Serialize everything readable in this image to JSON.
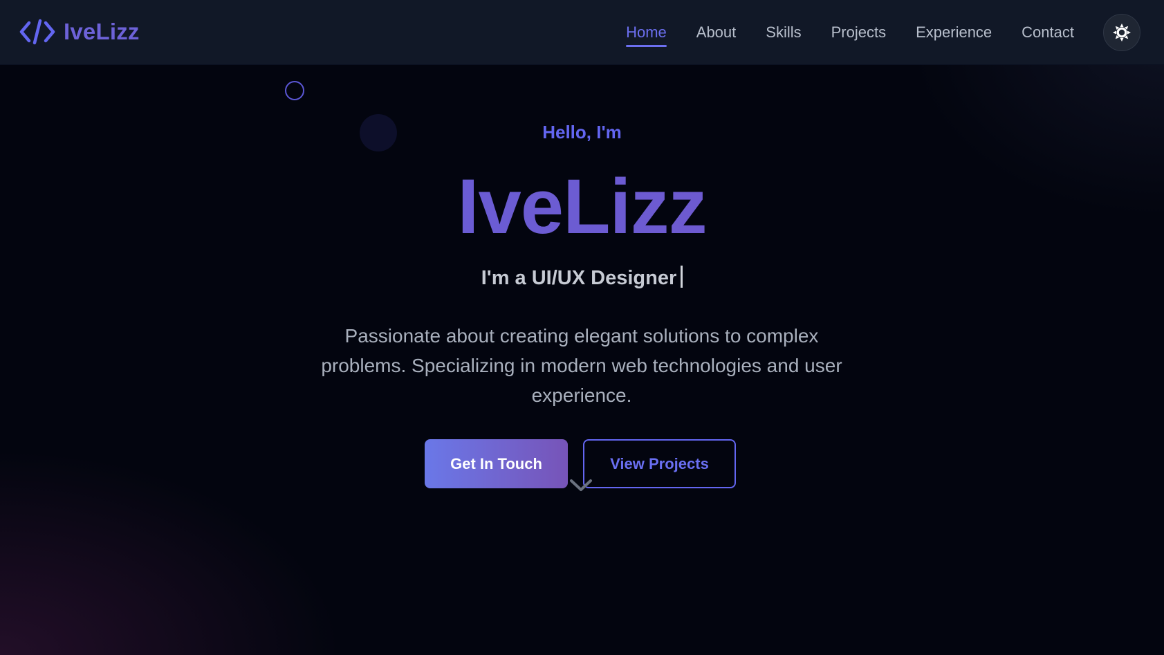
{
  "brand": {
    "name": "IveLizz",
    "icon": "code-brackets-icon"
  },
  "nav": {
    "items": [
      {
        "label": "Home",
        "active": true
      },
      {
        "label": "About",
        "active": false
      },
      {
        "label": "Skills",
        "active": false
      },
      {
        "label": "Projects",
        "active": false
      },
      {
        "label": "Experience",
        "active": false
      },
      {
        "label": "Contact",
        "active": false
      }
    ],
    "theme_toggle_icon": "sun-icon"
  },
  "hero": {
    "greeting": "Hello, I'm",
    "name": "IveLizz",
    "role": "I'm a UI/UX Designer",
    "description": "Passionate about creating elegant solutions to complex problems. Specializing in modern web technologies and user experience.",
    "primary_button": "Get In Touch",
    "secondary_button": "View Projects",
    "scroll_icon": "chevron-down-icon"
  },
  "colors": {
    "accent": "#6366f1",
    "brand_gradient_start": "#6a78e8",
    "brand_gradient_end": "#7754b8",
    "navbar_bg": "#111827",
    "page_bg": "#03050f"
  }
}
